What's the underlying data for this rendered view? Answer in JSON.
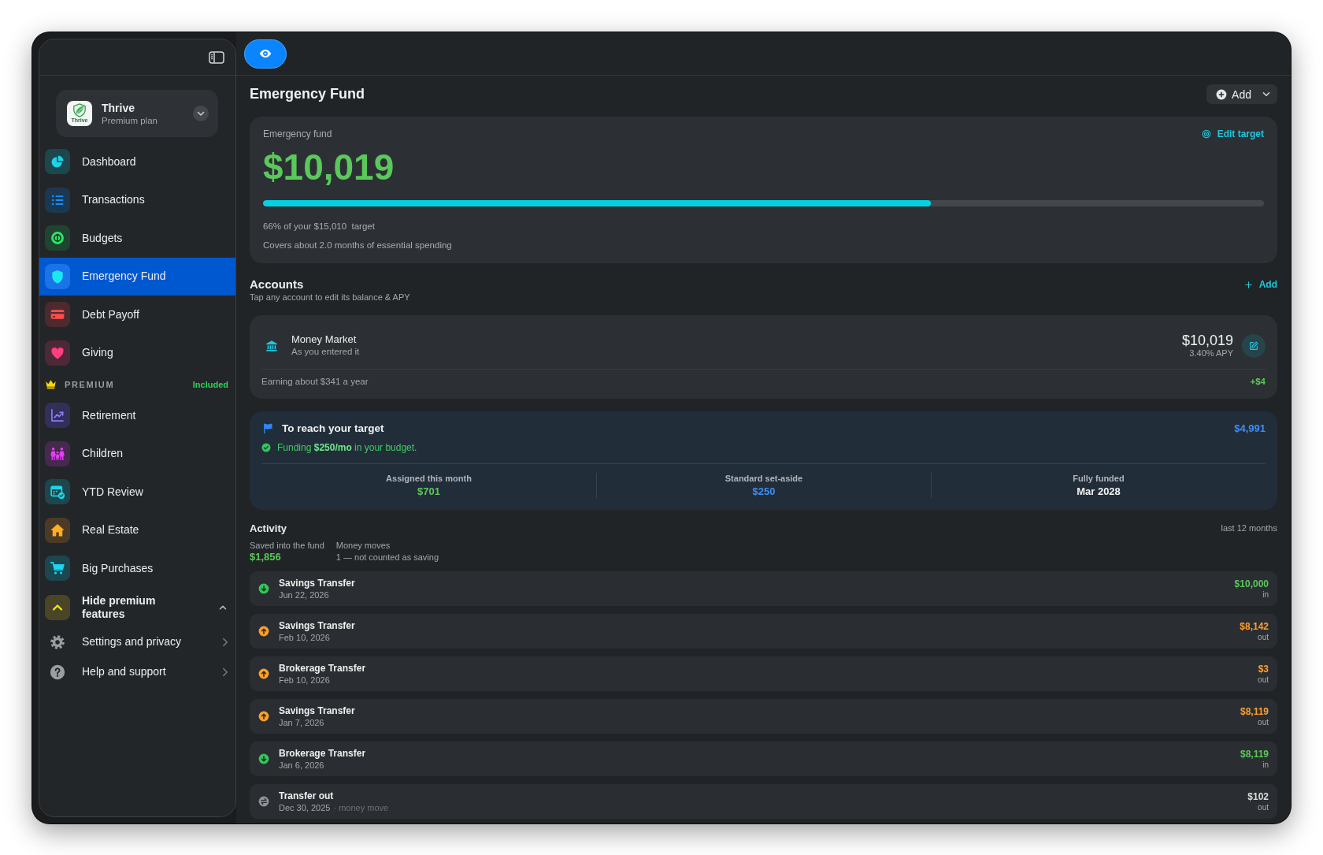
{
  "sidebar": {
    "profile": {
      "logo_text": "Thrive",
      "name": "Thrive",
      "plan": "Premium plan"
    },
    "items": [
      {
        "label": "Dashboard",
        "selected": false
      },
      {
        "label": "Transactions",
        "selected": false
      },
      {
        "label": "Budgets",
        "selected": false
      },
      {
        "label": "Emergency Fund",
        "selected": true
      },
      {
        "label": "Debt Payoff",
        "selected": false
      },
      {
        "label": "Giving",
        "selected": false
      }
    ],
    "premium": {
      "title": "PREMIUM",
      "badge": "Included",
      "items": [
        {
          "label": "Retirement",
          "selected": false
        },
        {
          "label": "Children",
          "selected": false
        },
        {
          "label": "YTD Review",
          "selected": false
        },
        {
          "label": "Real Estate",
          "selected": false
        },
        {
          "label": "Big Purchases",
          "selected": false
        }
      ],
      "toggle": {
        "label": "Hide premium features",
        "expanded": true
      }
    },
    "footer_items": [
      {
        "label": "Settings and privacy"
      },
      {
        "label": "Help and support"
      }
    ]
  },
  "page": {
    "title": "Emergency Fund",
    "add_button": "Add"
  },
  "fund_card": {
    "label": "Emergency fund",
    "edit_link": "Edit target",
    "amount": "$10,019",
    "level": 0.667,
    "progress_text": "66% of your $15,010  target",
    "coverage_text": "Covers about 2.0 months of essential spending"
  },
  "accounts": {
    "title": "Accounts",
    "subtitle": "Tap any account to edit its balance & APY",
    "add_link": "Add",
    "items": [
      {
        "name": "Money Market",
        "source": "As you entered it",
        "balance": "$10,019",
        "apy": "3.40% APY",
        "earning": "Earning about $341 a year",
        "change": "+$4"
      }
    ]
  },
  "target": {
    "title": "To reach your target",
    "remaining": "$4,991",
    "status": "Funding **$250/mo** in your budget.",
    "stats": [
      {
        "label": "Assigned this month",
        "value": "$701",
        "color": "#5ac85a"
      },
      {
        "label": "Standard set-aside",
        "value": "$250",
        "color": "#3d8ef5"
      },
      {
        "label": "Fully funded",
        "value": "Mar 2028",
        "color": "#f2f2f2"
      }
    ]
  },
  "activity": {
    "title": "Activity",
    "period": "last 12 months",
    "summary": [
      {
        "kind": "amount",
        "label": "Saved into the fund",
        "value": "$1,856"
      },
      {
        "kind": "note",
        "label": "Money moves",
        "value": "1 — not counted as saving"
      }
    ],
    "rows": [
      {
        "kind": "in",
        "title": "Savings Transfer",
        "date": "Jun 22, 2026",
        "amount": "$10,000",
        "flow": "in"
      },
      {
        "kind": "out",
        "title": "Savings Transfer",
        "date": "Feb 10, 2026",
        "amount": "$8,142",
        "flow": "out"
      },
      {
        "kind": "out",
        "title": "Brokerage Transfer",
        "date": "Feb 10, 2026",
        "amount": "$3",
        "flow": "out"
      },
      {
        "kind": "out",
        "title": "Savings Transfer",
        "date": "Jan 7, 2026",
        "amount": "$8,119",
        "flow": "out"
      },
      {
        "kind": "in",
        "title": "Brokerage Transfer",
        "date": "Jan 6, 2026",
        "amount": "$8,119",
        "flow": "in"
      },
      {
        "kind": "move",
        "title": "Transfer out",
        "date": "Dec 30, 2025",
        "note": "· money move",
        "amount": "$102",
        "flow": "out"
      }
    ]
  }
}
